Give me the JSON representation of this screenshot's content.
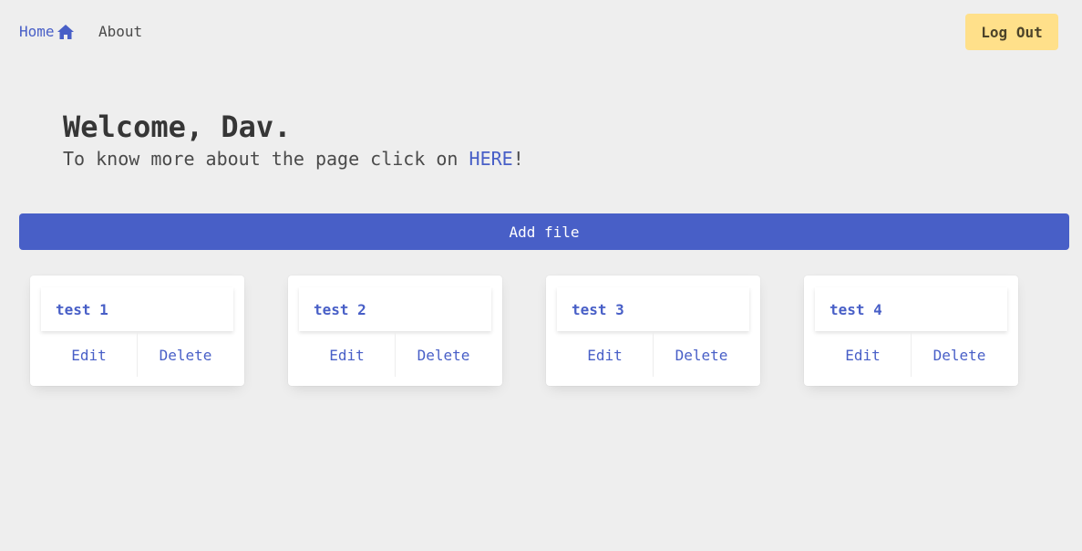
{
  "nav": {
    "home_label": "Home",
    "home_icon": "home-icon",
    "about_label": "About",
    "logout_label": "Log Out"
  },
  "hero": {
    "title": "Welcome, Dav.",
    "subtitle_prefix": "To know more about the page click on ",
    "link_label": "HERE",
    "subtitle_suffix": "!"
  },
  "add_file_label": "Add file",
  "files": [
    {
      "title": "test 1",
      "edit_label": "Edit",
      "delete_label": "Delete"
    },
    {
      "title": "test 2",
      "edit_label": "Edit",
      "delete_label": "Delete"
    },
    {
      "title": "test 3",
      "edit_label": "Edit",
      "delete_label": "Delete"
    },
    {
      "title": "test 4",
      "edit_label": "Edit",
      "delete_label": "Delete"
    }
  ],
  "colors": {
    "primary": "#485fc7",
    "warning": "#ffe08a",
    "background": "#eeeeee"
  }
}
